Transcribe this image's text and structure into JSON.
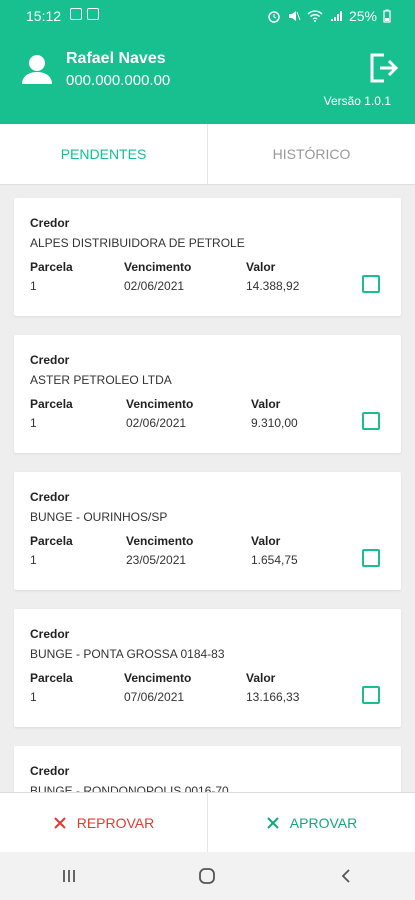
{
  "status_bar": {
    "time": "15:12",
    "battery": "25%"
  },
  "header": {
    "user_name": "Rafael Naves",
    "user_id": "000.000.000.00",
    "version": "Versão 1.0.1"
  },
  "tabs": [
    {
      "label": "PENDENTES",
      "active": true
    },
    {
      "label": "HISTÓRICO",
      "active": false
    }
  ],
  "labels": {
    "credor": "Credor",
    "parcela": "Parcela",
    "vencimento": "Vencimento",
    "valor": "Valor"
  },
  "items": [
    {
      "credor": "ALPES DISTRIBUIDORA DE PETROLE",
      "parcela": "1",
      "vencimento": "02/06/2021",
      "valor": "14.388,92",
      "checked": false
    },
    {
      "credor": "ASTER PETROLEO LTDA",
      "parcela": "1",
      "vencimento": "02/06/2021",
      "valor": "9.310,00",
      "checked": false
    },
    {
      "credor": "BUNGE - OURINHOS/SP",
      "parcela": "1",
      "vencimento": "23/05/2021",
      "valor": "1.654,75",
      "checked": false
    },
    {
      "credor": "BUNGE - PONTA GROSSA 0184-83",
      "parcela": "1",
      "vencimento": "07/06/2021",
      "valor": "13.166,33",
      "checked": false
    },
    {
      "credor": "BUNGE - RONDONOPOLIS 0016-70",
      "parcela": "",
      "vencimento": "",
      "valor": "",
      "checked": false
    }
  ],
  "actions": {
    "reject": "REPROVAR",
    "approve": "APROVAR"
  },
  "colors": {
    "primary": "#17c08e",
    "reject": "#e53935"
  }
}
